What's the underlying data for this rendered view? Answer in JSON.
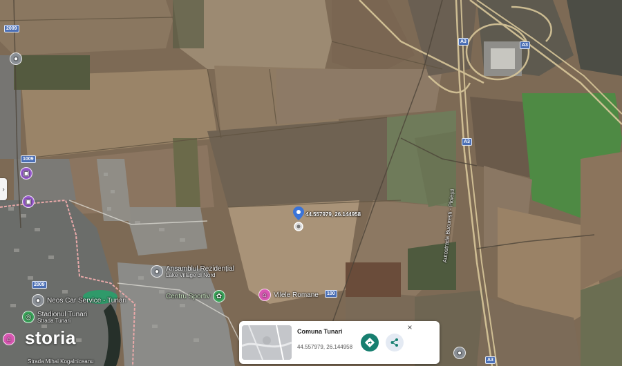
{
  "map": {
    "road_shields": [
      "2009",
      "1009",
      "2009",
      "100",
      "A3",
      "A3",
      "A3",
      "A3"
    ],
    "pois": [
      {
        "id": "ansamblul",
        "label_line1": "Ansamblul Rezidențial",
        "label_line2": "Lake Village di Nord",
        "icon": "map-pin-icon",
        "color": "#8a8f95"
      },
      {
        "id": "centru",
        "label_line1": "Centru Sportiv",
        "icon": "leaf-icon",
        "color": "#3aa35a"
      },
      {
        "id": "vilele",
        "label_line1": "Vilele Romane",
        "icon": "home-icon",
        "color": "#d857b2"
      },
      {
        "id": "service",
        "label_line1": "Neos Car Service - Tunari",
        "icon": "map-pin-icon",
        "color": "#8a8f95"
      },
      {
        "id": "stadion",
        "label_line1": "Stadionul Tunari",
        "label_line2": "Strada Tunari",
        "icon": "stadium-icon",
        "color": "#3aa35a"
      },
      {
        "id": "strada",
        "label_line1": "Strada Mihai Kogalniceanu",
        "icon": "none"
      },
      {
        "id": "highway_label",
        "label_line1": "Autostrada București - Ploiești"
      }
    ],
    "selected_pin": {
      "coords_label": "44.557979, 26.144958",
      "icon": "map-pin-icon",
      "color": "#3b74d8"
    }
  },
  "branding": {
    "logo_text": "storia"
  },
  "info_card": {
    "title": "Comuna Tunari",
    "coords": "44.557979, 26.144958",
    "close_label": "×",
    "directions_icon": "directions-icon",
    "share_icon": "share-icon"
  },
  "side_handle": {
    "label": "›"
  },
  "colors": {
    "accent": "#177f70",
    "pin": "#3b74d8",
    "map_base": "#7d6a55"
  }
}
